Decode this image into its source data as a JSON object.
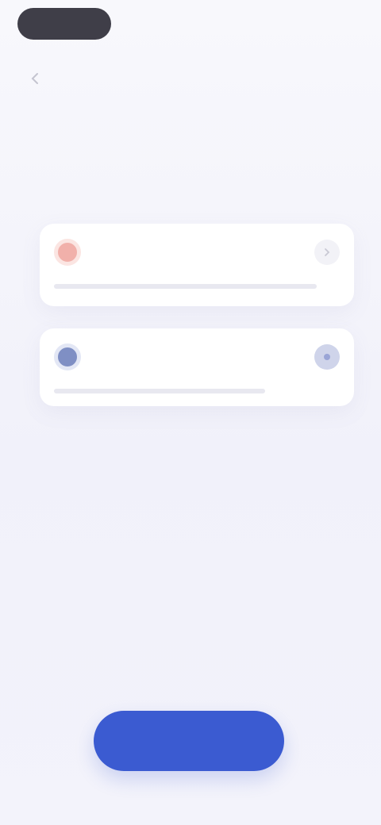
{
  "header": {
    "left_label": "",
    "middle_label": "",
    "right_label": ""
  },
  "cards": [
    {
      "title": "",
      "description": "",
      "accent": "#f1b0aa",
      "icon": "chevron-icon"
    },
    {
      "title": "",
      "description": "",
      "accent": "#7f8fc4",
      "icon": "toggle-icon"
    }
  ],
  "headline": {
    "line1": "",
    "line2": ""
  },
  "subtext": "",
  "cta": {
    "label": "",
    "color": "#3b5bd1"
  },
  "colors": {
    "background": "#f4f4fb",
    "dark_pill": "#3f3e48"
  }
}
